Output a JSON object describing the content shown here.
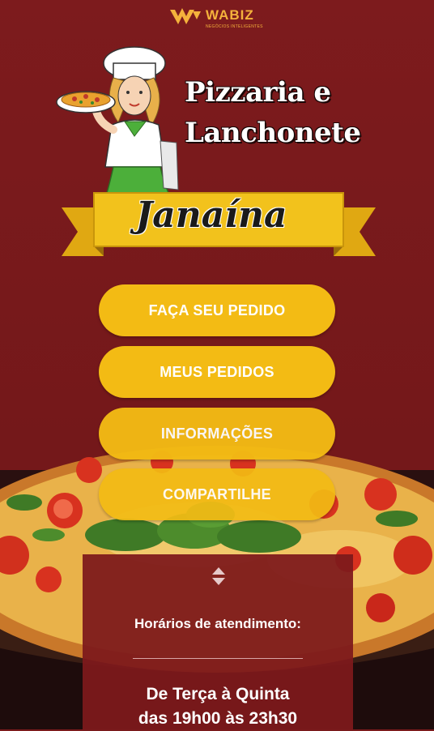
{
  "brand": {
    "logo": "WABIZ",
    "tagline": "NEGÓCIOS INTELIGENTES"
  },
  "header": {
    "title_line1": "Pizzaria e",
    "title_line2": "Lanchonete",
    "ribbon": "Janaína"
  },
  "menu": {
    "order": "FAÇA SEU PEDIDO",
    "my_orders": "MEUS PEDIDOS",
    "info": "INFORMAÇÕES",
    "share": "COMPARTILHE"
  },
  "hours": {
    "title": "Horários de atendimento:",
    "days": "De Terça à Quinta",
    "time": "das 19h00 às 23h30"
  },
  "colors": {
    "background": "#7a1a1c",
    "button": "#f3bb14",
    "ribbon": "#f2c21c"
  },
  "icons": {
    "chef": "chef-illustration-icon",
    "expand": "chevron-up-down-icon"
  }
}
